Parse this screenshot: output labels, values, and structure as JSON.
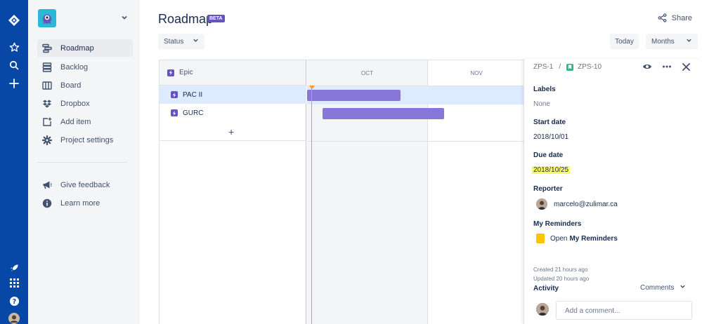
{
  "global_nav": {
    "icons": [
      "jira-logo-icon",
      "star-icon",
      "search-icon",
      "plus-icon",
      "rocket-icon",
      "app-switcher-icon",
      "help-icon",
      "user-avatar"
    ]
  },
  "sidebar": {
    "items": [
      {
        "label": "Roadmap",
        "icon": "roadmap-icon",
        "active": true
      },
      {
        "label": "Backlog",
        "icon": "backlog-icon"
      },
      {
        "label": "Board",
        "icon": "board-icon"
      },
      {
        "label": "Dropbox",
        "icon": "dropbox-icon"
      },
      {
        "label": "Add item",
        "icon": "add-item-icon"
      },
      {
        "label": "Project settings",
        "icon": "gear-icon"
      }
    ],
    "footer_items": [
      {
        "label": "Give feedback",
        "icon": "megaphone-icon"
      },
      {
        "label": "Learn more",
        "icon": "info-icon"
      }
    ]
  },
  "header": {
    "title": "Roadmap",
    "badge": "BETA",
    "share_label": "Share",
    "status_label": "Status",
    "today_label": "Today",
    "months_label": "Months"
  },
  "roadmap": {
    "column_header": "Epic",
    "months": [
      "OCT",
      "NOV"
    ],
    "epics": [
      {
        "name": "PAC II",
        "selected": true
      },
      {
        "name": "GURC",
        "selected": false
      }
    ],
    "add_label": "+"
  },
  "detail": {
    "breadcrumb": {
      "project_key": "ZPS-1",
      "issue_key": "ZPS-10"
    },
    "labels_title": "Labels",
    "labels_value": "None",
    "start_title": "Start date",
    "start_value": "2018/10/01",
    "due_title": "Due date",
    "due_value": "2018/10/25",
    "reporter_title": "Reporter",
    "reporter_value": "marcelo@zulimar.ca",
    "reminders_title": "My Reminders",
    "reminders_open": "Open",
    "reminders_link": "My Reminders",
    "created": "Created 21 hours ago",
    "updated": "Updated 20 hours ago",
    "activity_title": "Activity",
    "comments_label": "Comments",
    "comment_placeholder": "Add a comment..."
  },
  "colors": {
    "nav": "#0747a6",
    "epic": "#6554c0",
    "bar": "#8777d9",
    "today_line": "#ff991f",
    "highlight": "#ffff5c"
  }
}
